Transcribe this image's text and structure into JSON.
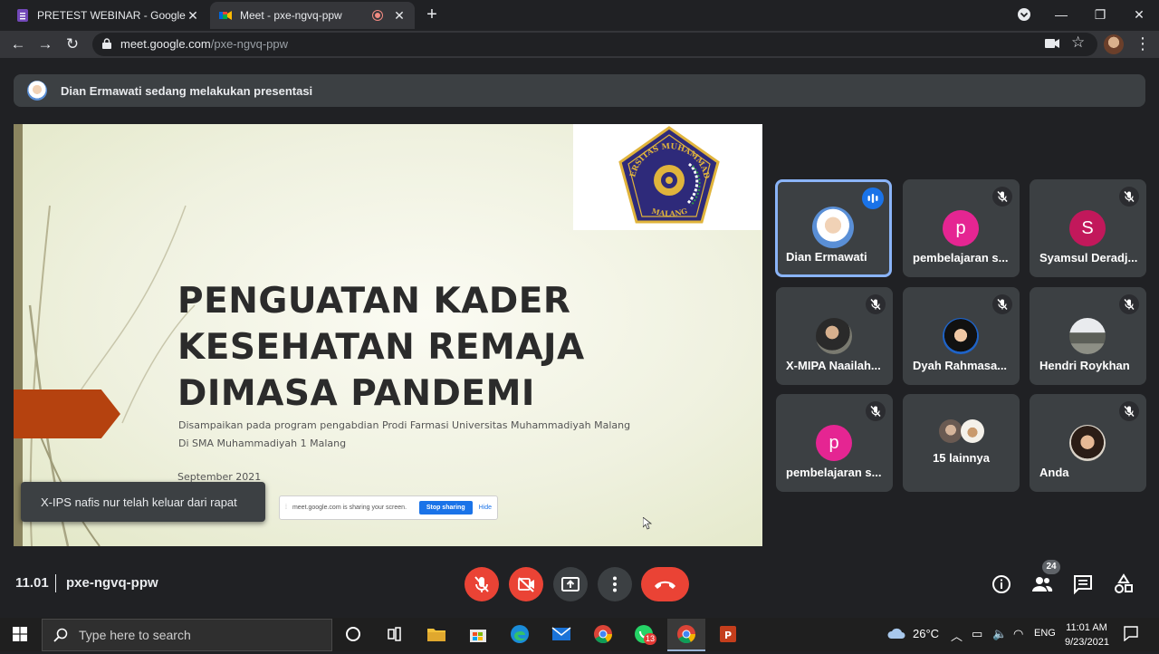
{
  "browser": {
    "tabs": [
      {
        "title": "PRETEST WEBINAR - Google Forms",
        "active": false
      },
      {
        "title": "Meet - pxe-ngvq-ppw",
        "active": true
      }
    ],
    "url_host": "meet.google.com",
    "url_path": "/pxe-ngvq-ppw"
  },
  "meet": {
    "presenting_banner": "Dian Ermawati sedang melakukan presentasi",
    "slide": {
      "title": "PENGUATAN KADER KESEHATAN REMAJA DIMASA PANDEMI",
      "subtitle_line1": "Disampaikan pada program pengabdian Prodi Farmasi Universitas Muhammadiyah Malang",
      "subtitle_line2": "Di SMA Muhammadiyah 1 Malang",
      "date": "September 2021",
      "logo_text_top": "UNIVERSITAS MUHAMMADIYAH",
      "logo_text_bottom": "MALANG",
      "share_bar": {
        "message": "meet.google.com is sharing your screen.",
        "stop_label": "Stop sharing",
        "hide_label": "Hide"
      }
    },
    "toast": "X-IPS nafis nur telah keluar dari rapat",
    "participants": [
      {
        "name": "Dian Ermawati",
        "speaking": true,
        "avatar": "photo"
      },
      {
        "name": "pembelajaran s...",
        "muted": true,
        "initial": "p",
        "color": "#e52592"
      },
      {
        "name": "Syamsul Deradj...",
        "muted": true,
        "initial": "S",
        "color": "#c2185b"
      },
      {
        "name": "X-MIPA Naailah...",
        "muted": true,
        "avatar": "photo"
      },
      {
        "name": "Dyah Rahmasa...",
        "muted": true,
        "avatar": "photo"
      },
      {
        "name": "Hendri Roykhan",
        "muted": true,
        "avatar": "photo"
      },
      {
        "name": "pembelajaran s...",
        "muted": true,
        "initial": "p",
        "color": "#e52592"
      },
      {
        "name": "15 lainnya",
        "group": true
      },
      {
        "name": "Anda",
        "muted": true,
        "avatar": "photo"
      }
    ],
    "time": "11.01",
    "meeting_code": "pxe-ngvq-ppw",
    "participant_count": "24"
  },
  "taskbar": {
    "search_placeholder": "Type here to search",
    "whatsapp_badge": "13",
    "temperature": "26°C",
    "language": "ENG",
    "time": "11:01 AM",
    "date": "9/23/2021"
  }
}
